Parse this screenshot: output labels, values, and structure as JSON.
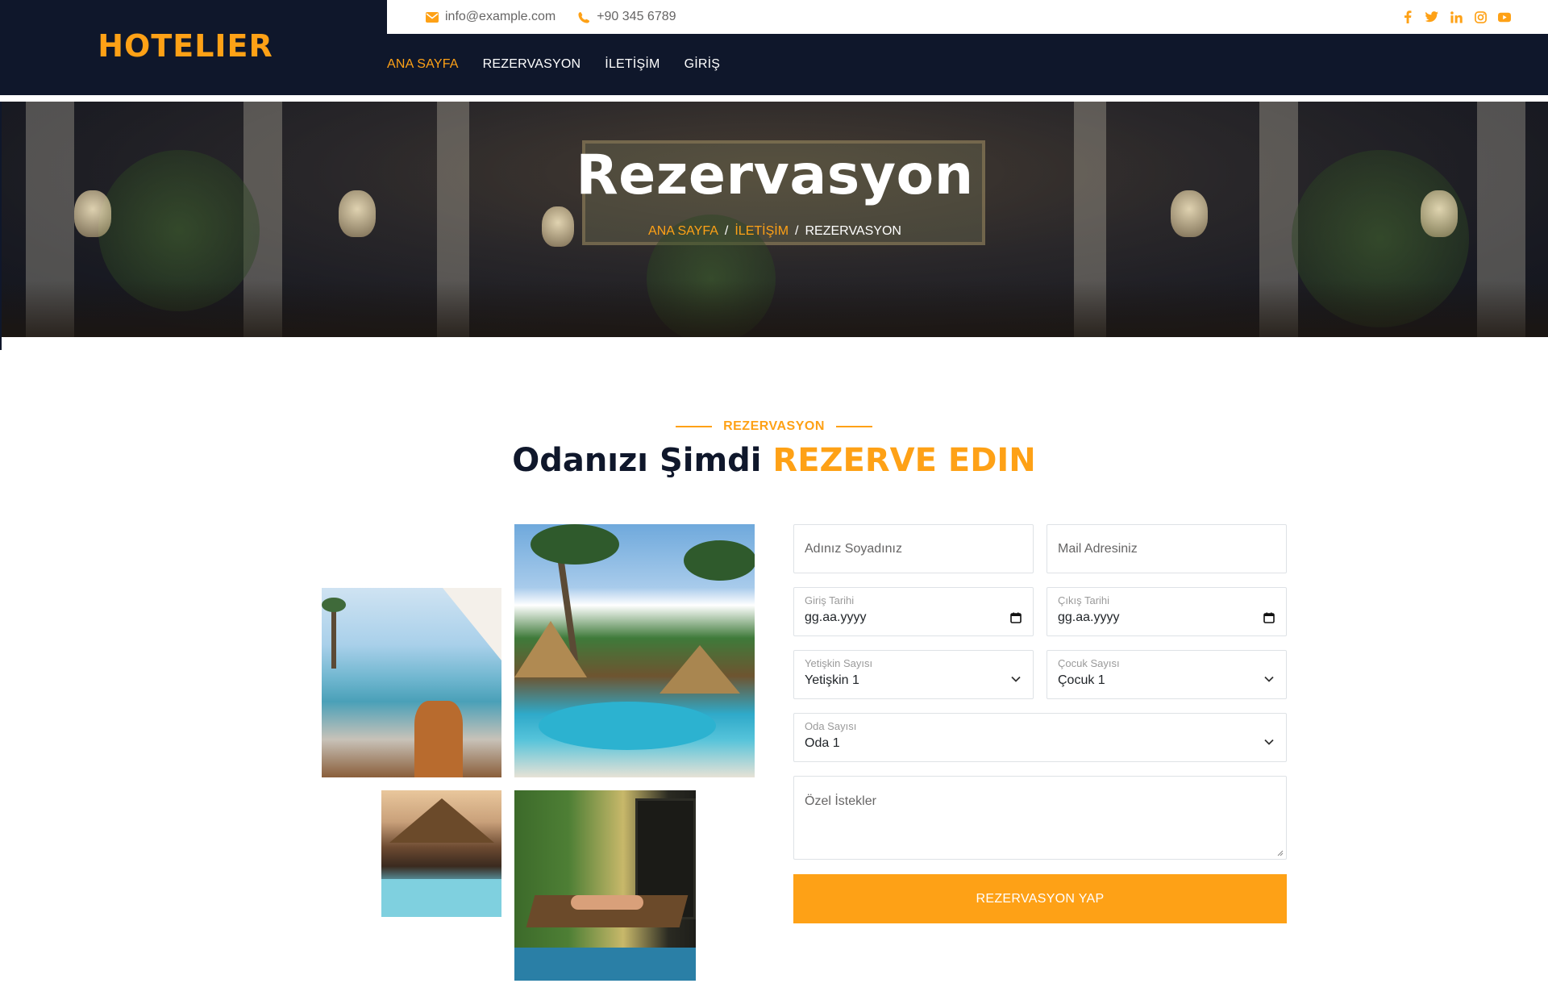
{
  "brand": {
    "name": "HOTELIER"
  },
  "topbar": {
    "email": "info@example.com",
    "phone": "+90 345 6789",
    "social": [
      "facebook-icon",
      "twitter-icon",
      "linkedin-icon",
      "instagram-icon",
      "youtube-icon"
    ]
  },
  "nav": {
    "items": [
      {
        "label": "ANA SAYFA",
        "active": true
      },
      {
        "label": "REZERVASYON",
        "active": false
      },
      {
        "label": "İLETİŞİM",
        "active": false
      },
      {
        "label": "GİRİŞ",
        "active": false
      }
    ]
  },
  "hero": {
    "title": "Rezervasyon",
    "breadcrumb": [
      "ANA SAYFA",
      "İLETİŞİM",
      "REZERVASYON"
    ],
    "separator": "/"
  },
  "section": {
    "kicker": "REZERVASYON",
    "title_plain": "Odanızı Şimdi",
    "title_accent": "REZERVE EDIN"
  },
  "form": {
    "name_placeholder": "Adınız Soyadınız",
    "email_placeholder": "Mail Adresiniz",
    "checkin": {
      "label": "Giriş Tarihi",
      "value": "gg.aa.yyyy"
    },
    "checkout": {
      "label": "Çıkış Tarihi",
      "value": "gg.aa.yyyy"
    },
    "adults": {
      "label": "Yetişkin Sayısı",
      "value": "Yetişkin 1"
    },
    "children": {
      "label": "Çocuk Sayısı",
      "value": "Çocuk 1"
    },
    "rooms": {
      "label": "Oda Sayısı",
      "value": "Oda 1"
    },
    "notes_placeholder": "Özel İstekler",
    "submit_label": "REZERVASYON YAP"
  },
  "colors": {
    "primary": "#FEA116",
    "dark": "#0F172B",
    "white": "#FFFFFF",
    "muted_text": "#666565",
    "border": "#DEE2E6"
  }
}
